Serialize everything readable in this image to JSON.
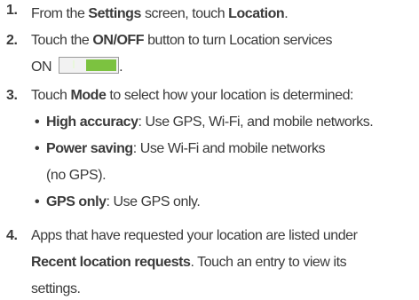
{
  "steps": [
    {
      "num": "1.",
      "parts": [
        "From the ",
        "Settings",
        " screen, touch ",
        "Location",
        "."
      ]
    },
    {
      "num": "2.",
      "line1": [
        "Touch the ",
        "ON/OFF",
        " button to turn Location services"
      ],
      "line2": [
        "ON",
        "."
      ]
    },
    {
      "num": "3.",
      "parts": [
        "Touch ",
        "Mode",
        " to select how your location is determined:"
      ],
      "bullets": [
        {
          "label": "High accuracy",
          "text": ": Use GPS, Wi-Fi, and mobile networks."
        },
        {
          "label": "Power saving",
          "text": ": Use Wi-Fi and mobile networks",
          "text2": "(no GPS)."
        },
        {
          "label": "GPS only",
          "text": ": Use GPS only."
        }
      ]
    },
    {
      "num": "4.",
      "line1": "Apps that have requested your location are listed under",
      "line2": [
        "Recent location requests",
        ". Touch an entry to view its"
      ],
      "line3": "settings."
    }
  ],
  "bullet_char": "•",
  "toggle": {
    "state": "on",
    "color": "#7cc240"
  }
}
